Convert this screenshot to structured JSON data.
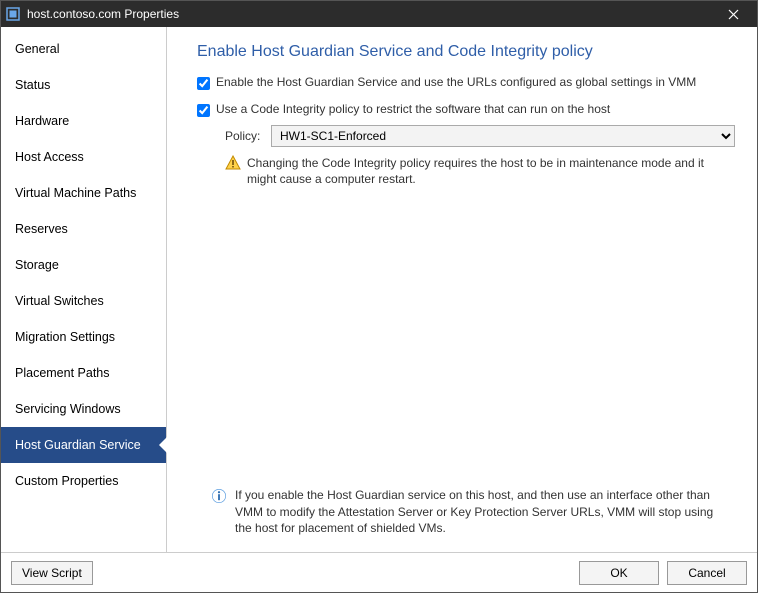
{
  "window": {
    "title": "host.contoso.com Properties"
  },
  "sidebar": {
    "items": [
      {
        "label": "General"
      },
      {
        "label": "Status"
      },
      {
        "label": "Hardware"
      },
      {
        "label": "Host Access"
      },
      {
        "label": "Virtual Machine Paths"
      },
      {
        "label": "Reserves"
      },
      {
        "label": "Storage"
      },
      {
        "label": "Virtual Switches"
      },
      {
        "label": "Migration Settings"
      },
      {
        "label": "Placement Paths"
      },
      {
        "label": "Servicing Windows"
      },
      {
        "label": "Host Guardian Service"
      },
      {
        "label": "Custom Properties"
      }
    ],
    "selected_index": 11
  },
  "content": {
    "heading": "Enable Host Guardian Service and Code Integrity policy",
    "check_hgs": {
      "label": "Enable the Host Guardian Service and use the URLs configured as global settings in VMM",
      "checked": true
    },
    "check_ci": {
      "label": "Use a Code Integrity policy to restrict the software that can run on the host",
      "checked": true
    },
    "policy": {
      "label": "Policy:",
      "selected": "HW1-SC1-Enforced"
    },
    "warning": "Changing the Code Integrity policy requires the host to be in maintenance mode and it might cause a computer restart.",
    "info": "If you enable the Host Guardian service on this host, and then use an interface other than VMM to modify the Attestation Server or Key Protection Server URLs, VMM will stop using the host for placement of shielded VMs."
  },
  "footer": {
    "view_script": "View Script",
    "ok": "OK",
    "cancel": "Cancel"
  }
}
